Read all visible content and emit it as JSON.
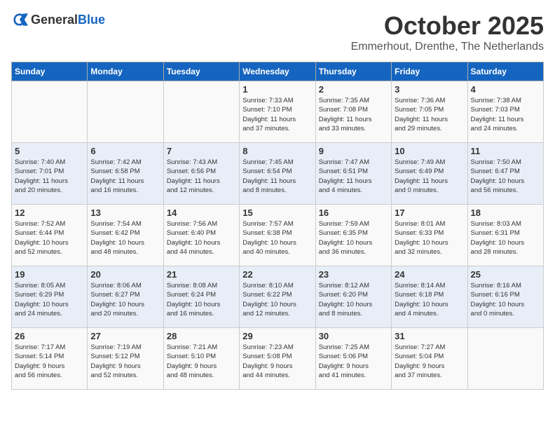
{
  "logo": {
    "general": "General",
    "blue": "Blue"
  },
  "title": "October 2025",
  "location": "Emmerhout, Drenthe, The Netherlands",
  "days_header": [
    "Sunday",
    "Monday",
    "Tuesday",
    "Wednesday",
    "Thursday",
    "Friday",
    "Saturday"
  ],
  "weeks": [
    [
      {
        "day": "",
        "content": ""
      },
      {
        "day": "",
        "content": ""
      },
      {
        "day": "",
        "content": ""
      },
      {
        "day": "1",
        "content": "Sunrise: 7:33 AM\nSunset: 7:10 PM\nDaylight: 11 hours\nand 37 minutes."
      },
      {
        "day": "2",
        "content": "Sunrise: 7:35 AM\nSunset: 7:08 PM\nDaylight: 11 hours\nand 33 minutes."
      },
      {
        "day": "3",
        "content": "Sunrise: 7:36 AM\nSunset: 7:05 PM\nDaylight: 11 hours\nand 29 minutes."
      },
      {
        "day": "4",
        "content": "Sunrise: 7:38 AM\nSunset: 7:03 PM\nDaylight: 11 hours\nand 24 minutes."
      }
    ],
    [
      {
        "day": "5",
        "content": "Sunrise: 7:40 AM\nSunset: 7:01 PM\nDaylight: 11 hours\nand 20 minutes."
      },
      {
        "day": "6",
        "content": "Sunrise: 7:42 AM\nSunset: 6:58 PM\nDaylight: 11 hours\nand 16 minutes."
      },
      {
        "day": "7",
        "content": "Sunrise: 7:43 AM\nSunset: 6:56 PM\nDaylight: 11 hours\nand 12 minutes."
      },
      {
        "day": "8",
        "content": "Sunrise: 7:45 AM\nSunset: 6:54 PM\nDaylight: 11 hours\nand 8 minutes."
      },
      {
        "day": "9",
        "content": "Sunrise: 7:47 AM\nSunset: 6:51 PM\nDaylight: 11 hours\nand 4 minutes."
      },
      {
        "day": "10",
        "content": "Sunrise: 7:49 AM\nSunset: 6:49 PM\nDaylight: 11 hours\nand 0 minutes."
      },
      {
        "day": "11",
        "content": "Sunrise: 7:50 AM\nSunset: 6:47 PM\nDaylight: 10 hours\nand 56 minutes."
      }
    ],
    [
      {
        "day": "12",
        "content": "Sunrise: 7:52 AM\nSunset: 6:44 PM\nDaylight: 10 hours\nand 52 minutes."
      },
      {
        "day": "13",
        "content": "Sunrise: 7:54 AM\nSunset: 6:42 PM\nDaylight: 10 hours\nand 48 minutes."
      },
      {
        "day": "14",
        "content": "Sunrise: 7:56 AM\nSunset: 6:40 PM\nDaylight: 10 hours\nand 44 minutes."
      },
      {
        "day": "15",
        "content": "Sunrise: 7:57 AM\nSunset: 6:38 PM\nDaylight: 10 hours\nand 40 minutes."
      },
      {
        "day": "16",
        "content": "Sunrise: 7:59 AM\nSunset: 6:35 PM\nDaylight: 10 hours\nand 36 minutes."
      },
      {
        "day": "17",
        "content": "Sunrise: 8:01 AM\nSunset: 6:33 PM\nDaylight: 10 hours\nand 32 minutes."
      },
      {
        "day": "18",
        "content": "Sunrise: 8:03 AM\nSunset: 6:31 PM\nDaylight: 10 hours\nand 28 minutes."
      }
    ],
    [
      {
        "day": "19",
        "content": "Sunrise: 8:05 AM\nSunset: 6:29 PM\nDaylight: 10 hours\nand 24 minutes."
      },
      {
        "day": "20",
        "content": "Sunrise: 8:06 AM\nSunset: 6:27 PM\nDaylight: 10 hours\nand 20 minutes."
      },
      {
        "day": "21",
        "content": "Sunrise: 8:08 AM\nSunset: 6:24 PM\nDaylight: 10 hours\nand 16 minutes."
      },
      {
        "day": "22",
        "content": "Sunrise: 8:10 AM\nSunset: 6:22 PM\nDaylight: 10 hours\nand 12 minutes."
      },
      {
        "day": "23",
        "content": "Sunrise: 8:12 AM\nSunset: 6:20 PM\nDaylight: 10 hours\nand 8 minutes."
      },
      {
        "day": "24",
        "content": "Sunrise: 8:14 AM\nSunset: 6:18 PM\nDaylight: 10 hours\nand 4 minutes."
      },
      {
        "day": "25",
        "content": "Sunrise: 8:16 AM\nSunset: 6:16 PM\nDaylight: 10 hours\nand 0 minutes."
      }
    ],
    [
      {
        "day": "26",
        "content": "Sunrise: 7:17 AM\nSunset: 5:14 PM\nDaylight: 9 hours\nand 56 minutes."
      },
      {
        "day": "27",
        "content": "Sunrise: 7:19 AM\nSunset: 5:12 PM\nDaylight: 9 hours\nand 52 minutes."
      },
      {
        "day": "28",
        "content": "Sunrise: 7:21 AM\nSunset: 5:10 PM\nDaylight: 9 hours\nand 48 minutes."
      },
      {
        "day": "29",
        "content": "Sunrise: 7:23 AM\nSunset: 5:08 PM\nDaylight: 9 hours\nand 44 minutes."
      },
      {
        "day": "30",
        "content": "Sunrise: 7:25 AM\nSunset: 5:06 PM\nDaylight: 9 hours\nand 41 minutes."
      },
      {
        "day": "31",
        "content": "Sunrise: 7:27 AM\nSunset: 5:04 PM\nDaylight: 9 hours\nand 37 minutes."
      },
      {
        "day": "",
        "content": ""
      }
    ]
  ]
}
